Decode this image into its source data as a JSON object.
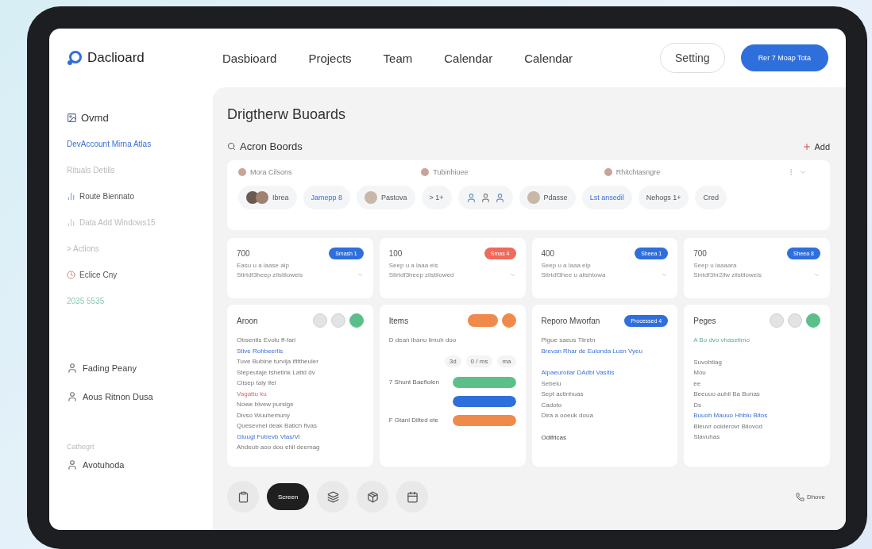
{
  "brand": {
    "name": "Daclioard"
  },
  "nav": [
    {
      "label": "Dasbioard"
    },
    {
      "label": "Projects"
    },
    {
      "label": "Team"
    },
    {
      "label": "Calendar"
    },
    {
      "label": "Calendar"
    }
  ],
  "setting_button": {
    "label": "Setting"
  },
  "primary_button": {
    "label": "Rer 7 Moap Tota"
  },
  "sidebar": {
    "items": [
      {
        "kind": "title",
        "label": "Ovmd"
      },
      {
        "kind": "link",
        "label": "DevAccount Mirna Atlas"
      },
      {
        "kind": "muted",
        "label": "Rituals Detills"
      },
      {
        "kind": "icon",
        "label": "Route Biennato"
      },
      {
        "kind": "muted-icon",
        "label": "Data Add Windows15"
      },
      {
        "kind": "muted",
        "label": "> Actions"
      },
      {
        "kind": "user",
        "label": "Eclice Cny"
      },
      {
        "kind": "date",
        "label": "2035 5535"
      }
    ],
    "people": [
      {
        "name": "Fading Peany"
      },
      {
        "name": "Aous Ritnon Dusa"
      }
    ],
    "section_label": "Cathegrt",
    "footer_user": {
      "name": "Avotuhoda"
    }
  },
  "main": {
    "title": "Drigtherw Buoards",
    "subtitle": "Acron Boords",
    "add_button": {
      "label": "Add"
    },
    "filters": {
      "labels": [
        "Mora Cilsons",
        "Tubinhiuee",
        "Rhitchtasngre"
      ],
      "chips": [
        {
          "kind": "avatars",
          "label": "Ibrea"
        },
        {
          "kind": "link",
          "label": "Jamepp 8"
        },
        {
          "kind": "avatar",
          "label": "Pastova"
        },
        {
          "kind": "plain",
          "label": "> 1+"
        },
        {
          "kind": "people"
        },
        {
          "kind": "avatar",
          "label": "Pdasse"
        },
        {
          "kind": "link",
          "label": "Lst ansedil"
        },
        {
          "kind": "plain",
          "label": "Nehogs 1+"
        },
        {
          "kind": "plain",
          "label": "Cred"
        }
      ]
    },
    "stats": [
      {
        "value": "700",
        "badge": {
          "label": "Smash 1",
          "color": "#2f6fdc"
        },
        "lines": [
          "Easu u a laase aip",
          "Stirtdf3heep zilstiloweis"
        ]
      },
      {
        "value": "100",
        "badge": {
          "label": "Smas 4",
          "color": "#ef6a5a"
        },
        "lines": [
          "Seep u a laaa eis",
          "Stirtdf3heep zilstilowed"
        ]
      },
      {
        "value": "400",
        "badge": {
          "label": "Sheea 1",
          "color": "#2f6fdc"
        },
        "lines": [
          "Seep u a laaa eip",
          "Stirtdf3hee u alishtowa"
        ]
      },
      {
        "value": "700",
        "badge": {
          "label": "Sheea 8",
          "color": "#2f6fdc"
        },
        "lines": [
          "Seep u laaaara",
          "Sintdf3hr2ilw zilstiloweis"
        ]
      }
    ],
    "columns": [
      {
        "title": "Aroon",
        "actions": [
          {
            "kind": "ghost"
          },
          {
            "kind": "ghost"
          },
          {
            "kind": "accent",
            "color": "#5cbf8a"
          }
        ],
        "lines": [
          {
            "kind": "plain",
            "text": "Obsentis Evolu ff-fari"
          },
          {
            "kind": "link",
            "text": "Stive Rohbeerlis"
          },
          {
            "kind": "plain",
            "text": "Tuve Bubine turvija ifittheuler"
          },
          {
            "kind": "plain",
            "text": "Stepeutaje tshetink Lattd dv"
          },
          {
            "kind": "plain",
            "text": "Clisep taly ifel"
          },
          {
            "kind": "alert",
            "text": "Vagattu ku"
          },
          {
            "kind": "plain",
            "text": "Nowe bivew pursige"
          },
          {
            "kind": "plain",
            "text": "Divso Wuuhemuny"
          },
          {
            "kind": "plain",
            "text": "Quesevnel deak Batich fivas"
          },
          {
            "kind": "link",
            "text": "Gluugl Futrevb Vlas/Vi"
          },
          {
            "kind": "plain",
            "text": "Ahdeub aoo dou ehil deemag"
          }
        ]
      },
      {
        "title": "Items",
        "actions": [
          {
            "kind": "toggle",
            "color": "#f08a4b"
          },
          {
            "kind": "accent",
            "color": "#f08a4b"
          }
        ],
        "lines": [
          {
            "kind": "plain",
            "text": "D dean ibanu ilmuh doo"
          }
        ],
        "control": [
          "3d",
          "0 / ms",
          "ma"
        ],
        "bars": [
          {
            "label": "7 Shunt Baefiolen",
            "color": "#5cbf8a",
            "level": 1
          },
          {
            "color": "#2f6fdc",
            "level": 1
          },
          {
            "label": "F Gtanl Dilted ete",
            "color": "#f08a4b",
            "level": 1
          }
        ]
      },
      {
        "title": "Reporo Mworfan",
        "badge": {
          "label": "Processed 4",
          "color": "#2f6fdc"
        },
        "lines": [
          {
            "kind": "plain",
            "text": "Pigue saeus Tiiretn"
          },
          {
            "kind": "link",
            "text": "Brevan Rhar de Eulonda Lusn Vyeu"
          },
          {
            "kind": "gap"
          },
          {
            "kind": "link",
            "text": "Alpaeuroilar DAdbl Vasitis"
          },
          {
            "kind": "plain",
            "text": "Sebelu"
          },
          {
            "kind": "plain",
            "text": "Sept actinhuas"
          },
          {
            "kind": "plain",
            "text": "Cadoto"
          },
          {
            "kind": "plain",
            "text": "Dira a ooeuk doua"
          },
          {
            "kind": "gap"
          },
          {
            "kind": "strong",
            "text": "Odlfrlcas"
          }
        ]
      },
      {
        "title": "Peges",
        "actions": [
          {
            "kind": "ghost"
          },
          {
            "kind": "ghost"
          },
          {
            "kind": "accent",
            "color": "#5cbf8a"
          }
        ],
        "lines": [
          {
            "kind": "green",
            "text": "A Bo dvo vhasetimo"
          },
          {
            "kind": "gap"
          },
          {
            "kind": "plain",
            "text": "Suvohtiag"
          },
          {
            "kind": "plain",
            "text": "Mou"
          },
          {
            "kind": "plain",
            "text": "ee"
          },
          {
            "kind": "plain",
            "text": "Beeuuo auhil Ba Bunas"
          },
          {
            "kind": "plain",
            "text": "Ds"
          },
          {
            "kind": "link",
            "text": "Buuoh Mauuo Hhblu Bitos"
          },
          {
            "kind": "plain",
            "text": "Bleuvr ooiderovr Biiovod"
          },
          {
            "kind": "plain",
            "text": "Slavuhas"
          }
        ]
      }
    ],
    "dock": [
      {
        "kind": "icon"
      },
      {
        "kind": "pill",
        "label": "Screen",
        "selected": true
      },
      {
        "kind": "icon"
      },
      {
        "kind": "icon"
      },
      {
        "kind": "icon"
      }
    ],
    "dock_right": {
      "label": "Dhove"
    }
  }
}
